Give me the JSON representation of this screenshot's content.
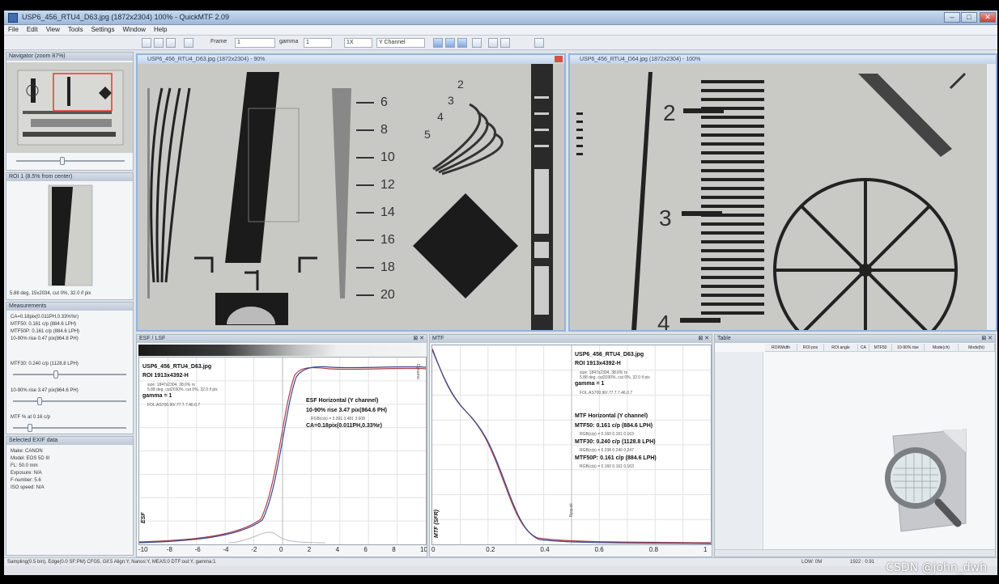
{
  "window": {
    "title": "USP6_456_RTU4_D63.jpg (1872x2304) 100% - QuickMTF 2.09"
  },
  "menu": [
    "File",
    "Edit",
    "View",
    "Tools",
    "Settings",
    "Window",
    "Help"
  ],
  "toolbar": {
    "frame_label": "Frame",
    "frame_value": "1",
    "gamma_label": "gamma",
    "gamma_value": "1",
    "zoom_value": "1X",
    "channel_value": "Y Channel"
  },
  "navigator": {
    "title": "Navigator (zoom 87%)"
  },
  "roi_panel": {
    "title": "ROI 1 (8.5% from center)",
    "caption": "5.88 deg, 15x2034, cut 0%, 32.0 if pix"
  },
  "measurements": {
    "title": "Measurements",
    "lines": [
      "CA=0.18pix(0.011PH,0.33%%r)",
      "MTF50: 0.161 c/p (884.6 LPH)",
      "MTF50P: 0.161 c/p (884.6 LPH)",
      "10-90% rise 0.47 pix(864.8 PH)"
    ],
    "mtf30_label": "MTF30: 0.240 c/p (1128.8 LPH)",
    "rise_label": "10-90% rise 3.47 pix(864.6 PH)",
    "mtf_at_label": "MTF % at 0.16 c/p"
  },
  "exif": {
    "title": "Selected EXIF data",
    "lines": [
      "Make: CANON",
      "Model: EOS 5D III",
      "FL: 50.0 mm",
      "Exposure: N/A",
      "F-number: 5.6",
      "ISO speed: N/A"
    ]
  },
  "left_image": {
    "title": "USP6_456_RTU4_D63.jpg (1872x2304) - 90%",
    "scale_labels": [
      "6",
      "8",
      "10",
      "12",
      "14",
      "16",
      "18",
      "20"
    ],
    "fan_labels": [
      "2",
      "3",
      "4",
      "5"
    ]
  },
  "right_image": {
    "title": "USP6_456_RTU4_D64.jpg (1872x2304) - 100%",
    "scale_labels": [
      "2",
      "3",
      "4"
    ]
  },
  "esf_plot": {
    "panel_title": "ESF / LSF",
    "file": "USP6_456_RTU4_D63.jpg",
    "roi": "ROI 1913x4392-H",
    "info_small": [
      "size: 1847x2304, 38.6% rs",
      "5.88 deg, cut2030%, cut 0%, 32.0 if pix"
    ],
    "gamma": "gamma = 1",
    "info_small2": "FOL:AS700.90/.77.7.7.46.0.7",
    "heading": "ESF Horizontal (Y channel)",
    "rise": "10-90% rise 3.47 pix(864.6 PH)",
    "rise_small": "RGB(c/p) = 3.391 3.481 3.608",
    "ca": "CA=0.18pix(0.011PH,0.33%r)",
    "ylabel": "ESF",
    "side_label": "Dynamic",
    "x_ticks": [
      "-10",
      "-8",
      "-6",
      "-4",
      "-2",
      "0",
      "2",
      "4",
      "6",
      "8",
      "10"
    ]
  },
  "mtf_plot": {
    "panel_title": "MTF",
    "file": "USP6_456_RTU4_D63.jpg",
    "roi": "ROI 1913x4392-H",
    "info_small": [
      "size: 1847x2304, 38.6% rs",
      "5.88 deg, cut2030%, cut 0%, 32.0 if pix"
    ],
    "gamma": "gamma = 1",
    "info_small2": "FOL:AS700.90/.77.7.7.46.0.7",
    "heading": "MTF Horizontal (Y channel)",
    "mtf50": "MTF50: 0.161 c/p (884.6 LPH)",
    "mtf50_small": "RGB(c/p) = 0.160 0.161 0.163",
    "mtf30": "MTF30: 0.240 c/p (1128.8 LPH)",
    "mtf30_small": "RGB(c/p) = 0.238 0.240 0.247",
    "mtf50p": "MTF50P: 0.161 c/p (884.6 LPH)",
    "mtf50p_small": "RGB(c/p) = 0.160 0.161 0.163",
    "ylabel": "MTF (SFR)",
    "side_label": "Nyquist",
    "x_ticks": [
      "0",
      "0.2",
      "0.4",
      "0.6",
      "0.8",
      "1"
    ]
  },
  "table": {
    "panel_title": "Table",
    "columns": [
      "ROI/Width",
      "ROI pos",
      "ROI angle",
      "CA",
      "MTF50",
      "10-90% rise",
      "Mode(ch)",
      "Mode(hi)"
    ]
  },
  "statusbar": {
    "text": "Sampling(0.5 bin), Edge(0.0 SF:PM) CFG5, Gif.5 Align:Y, Nanos:Y, MEAS:0 DTF:out:Y, gamma:1",
    "right1": "LOW: 0M",
    "right2": "1922 : 0.91"
  },
  "watermark": "CSDN @john_dwh",
  "colors": {
    "accent": "#93b4de",
    "curve_red": "#b0404a",
    "curve_blue": "#3a4a8c"
  }
}
